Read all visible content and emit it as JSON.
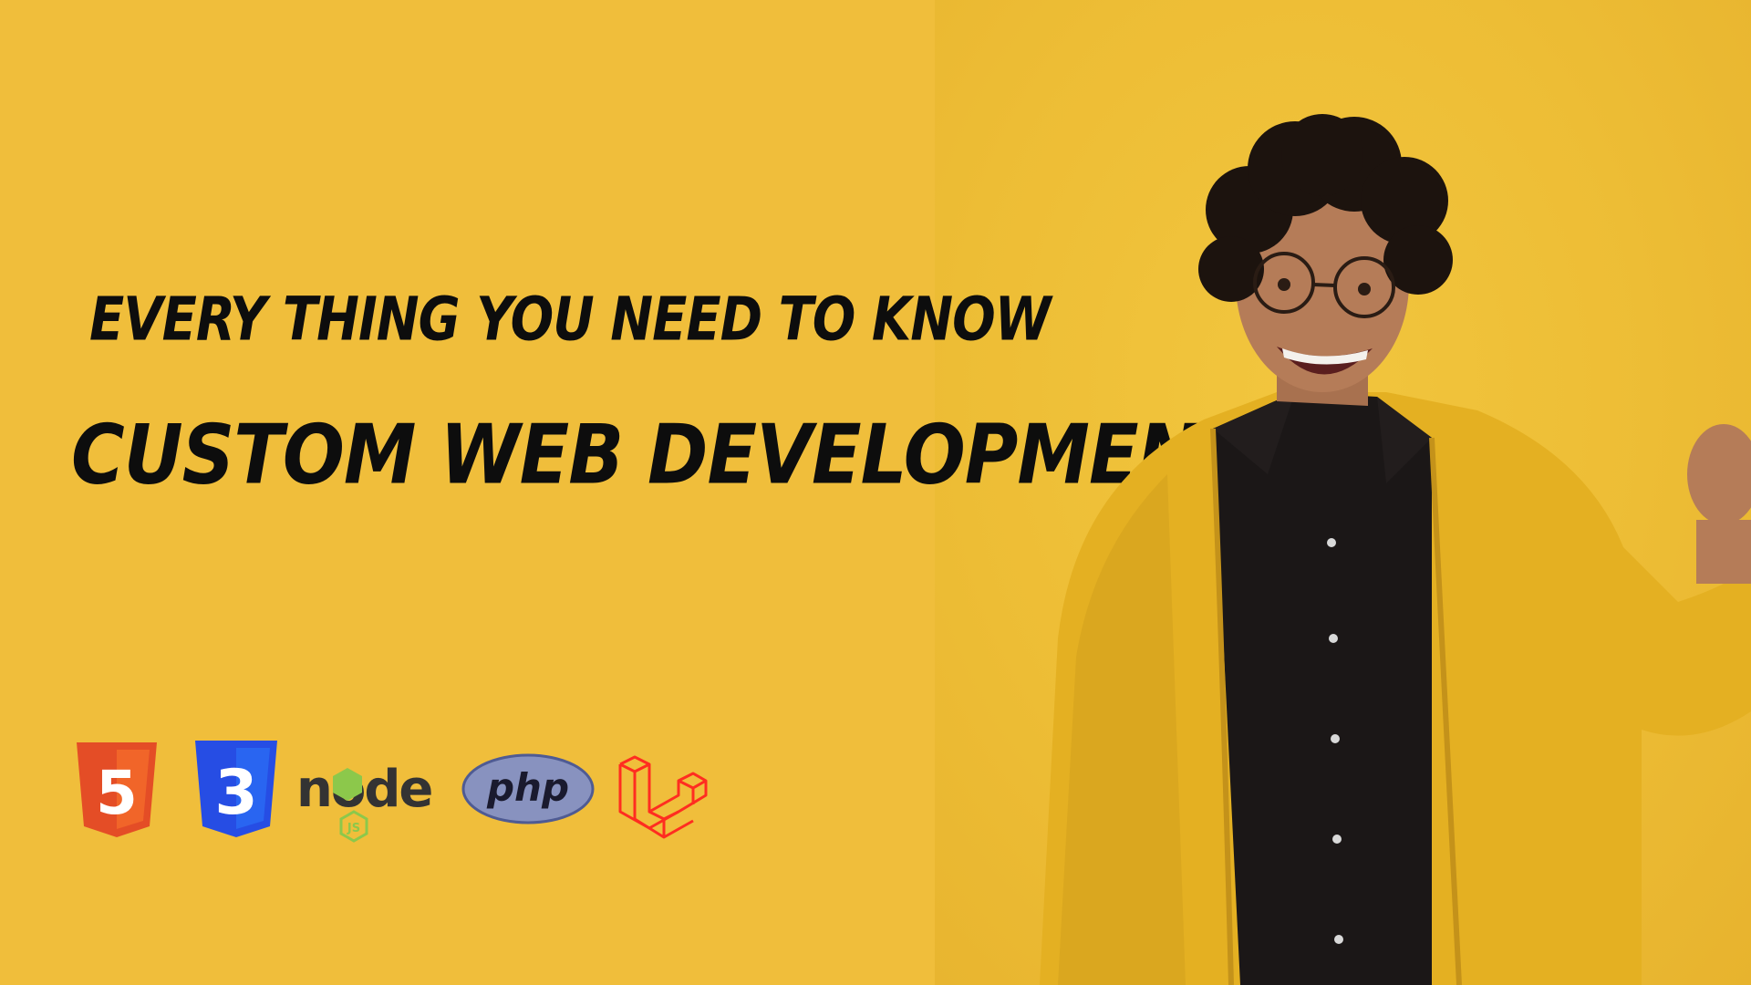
{
  "headline": {
    "kicker": "EVERY THING YOU NEED TO KNOW",
    "title": "CUSTOM WEB DEVELOPMENT"
  },
  "logos": [
    {
      "name": "html5-logo",
      "label": "5"
    },
    {
      "name": "css3-logo",
      "label": "3"
    },
    {
      "name": "nodejs-logo",
      "label": "node",
      "badge": "JS"
    },
    {
      "name": "php-logo",
      "label": "php"
    },
    {
      "name": "laravel-logo"
    }
  ],
  "colors": {
    "background": "#f0be3b",
    "text": "#0d0d0d",
    "html5": "#e44d26",
    "css3": "#264de4",
    "node_text": "#333333",
    "node_green": "#8cc84b",
    "php": "#8892bf",
    "laravel": "#ff2d20",
    "jacket": "#e4b022",
    "shirt": "#1b1717"
  }
}
